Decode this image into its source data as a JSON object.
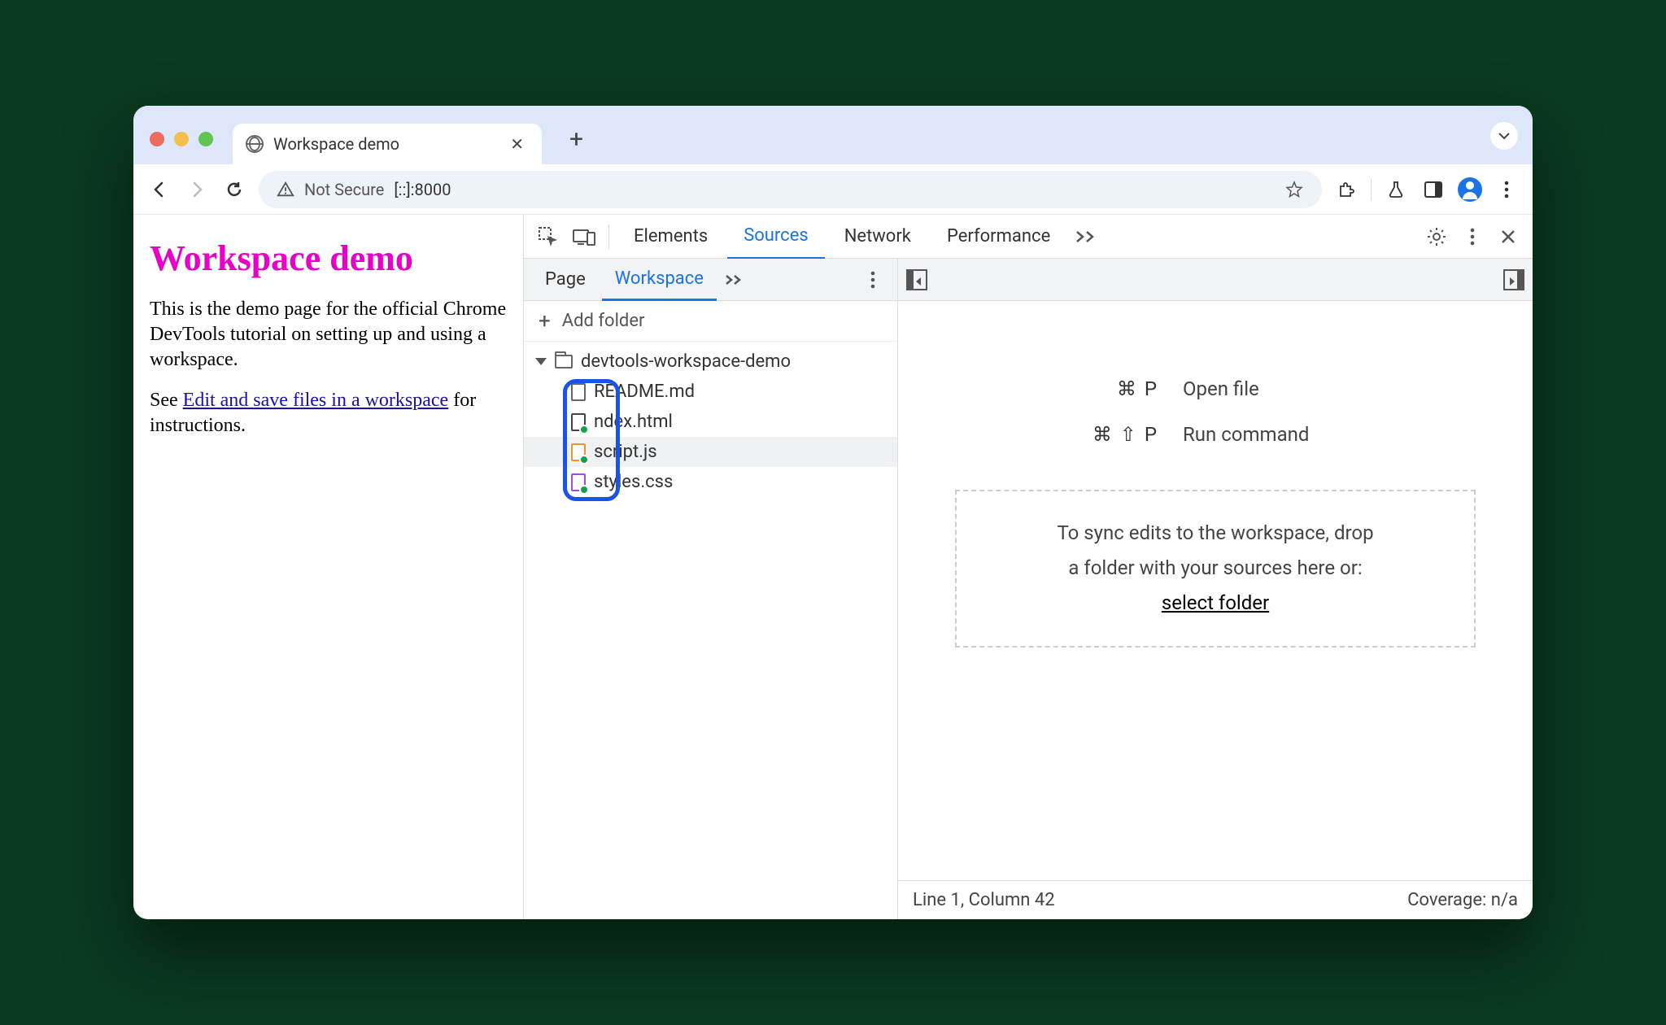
{
  "browser": {
    "tab_title": "Workspace demo",
    "url": "[::]:8000",
    "security_label": "Not Secure"
  },
  "page": {
    "heading": "Workspace demo",
    "paragraph1": "This is the demo page for the official Chrome DevTools tutorial on setting up and using a workspace.",
    "paragraph2_pre": "See ",
    "paragraph2_link": "Edit and save files in a workspace",
    "paragraph2_post": " for instructions."
  },
  "devtools": {
    "tabs": {
      "elements": "Elements",
      "sources": "Sources",
      "network": "Network",
      "performance": "Performance"
    },
    "navigator": {
      "tabs": {
        "page": "Page",
        "workspace": "Workspace"
      },
      "add_folder": "Add folder",
      "folder": "devtools-workspace-demo",
      "files": {
        "readme": "README.md",
        "index": "ndex.html",
        "script": "script.js",
        "styles": "styles.css"
      }
    },
    "shortcuts": {
      "open_keys": "⌘ P",
      "open_text": "Open file",
      "run_keys": "⌘ ⇧ P",
      "run_text": "Run command"
    },
    "drop": {
      "line1": "To sync edits to the workspace, drop",
      "line2": "a folder with your sources here or:",
      "action": "select folder"
    },
    "status": {
      "position": "Line 1, Column 42",
      "coverage": "Coverage: n/a"
    }
  }
}
